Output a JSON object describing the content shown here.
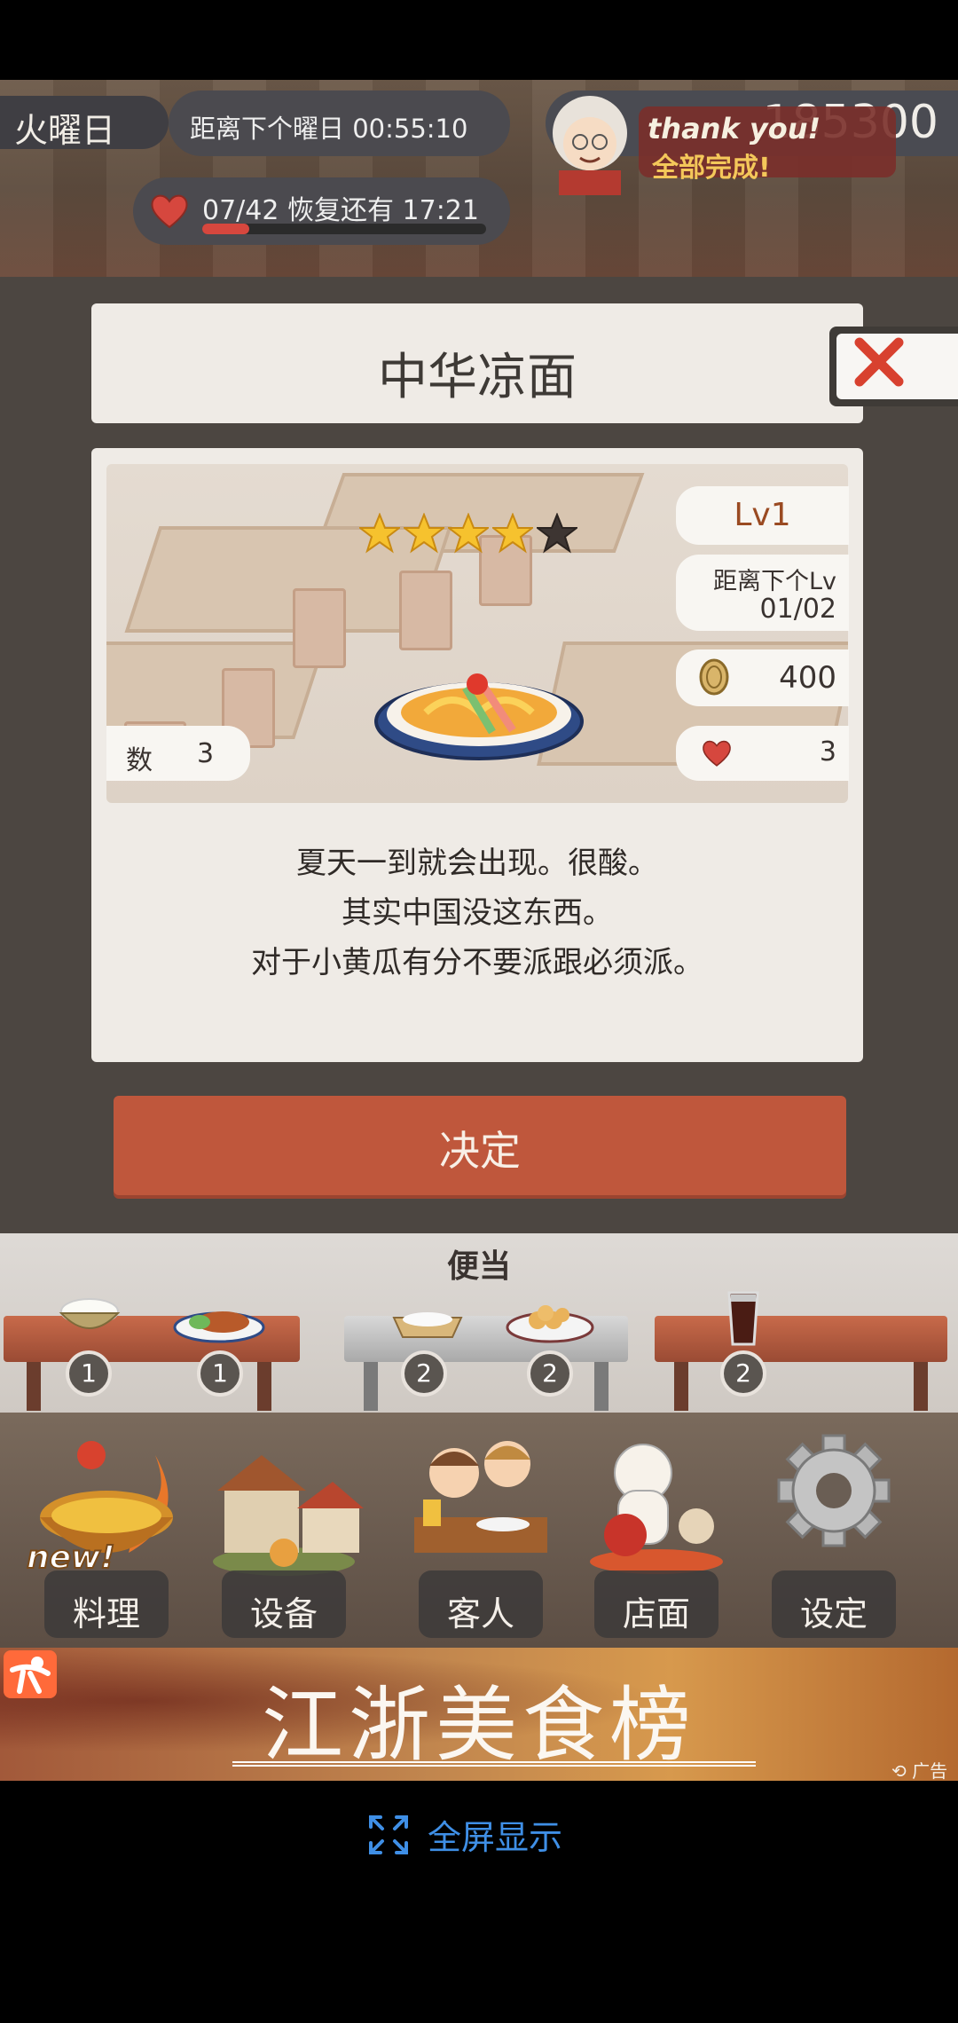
{
  "hud": {
    "weekday": "火曜日",
    "next_weekday_label": "距离下个曜日 00:55:10",
    "hearts_label": "07/42  恢复还有  17:21",
    "hearts_fraction": 0.1667,
    "coins": "185300",
    "banner_line1": "thank you!",
    "banner_line2": "全部完成!"
  },
  "dish": {
    "name": "中华凉面",
    "stars_filled": 4,
    "stars_total": 5,
    "level": "Lv1",
    "next_lv_label": "距离下个Lv",
    "next_lv_progress": "01/02",
    "price": "400",
    "hearts": "3",
    "count_label": "数",
    "count_value": "3",
    "description": [
      "夏天一到就会出现。很酸。",
      "其实中国没这东西。",
      "对于小黄瓜有分不要派跟必须派。"
    ]
  },
  "confirm_label": "决定",
  "bento": {
    "title": "便当",
    "slots": [
      {
        "item": "rice-bowl",
        "count": "1"
      },
      {
        "item": "katsu-plate",
        "count": "1"
      },
      {
        "item": "rice-tray",
        "count": "2"
      },
      {
        "item": "dumpling-plate",
        "count": "2"
      },
      {
        "item": "cola-glass",
        "count": "2"
      }
    ]
  },
  "menu": {
    "new_badge": "new!",
    "items": [
      {
        "label": "料理",
        "icon": "cooking-pot-icon"
      },
      {
        "label": "设备",
        "icon": "house-icon"
      },
      {
        "label": "客人",
        "icon": "customers-icon"
      },
      {
        "label": "店面",
        "icon": "lucky-cat-icon"
      },
      {
        "label": "设定",
        "icon": "gear-icon"
      }
    ]
  },
  "ad": {
    "headline": "江浙美食榜",
    "mark": "广告"
  },
  "fullscreen_label": "全屏显示",
  "colors": {
    "accent": "#bf573c",
    "level": "#9a4a22",
    "fullscreen": "#3f8fe6"
  }
}
